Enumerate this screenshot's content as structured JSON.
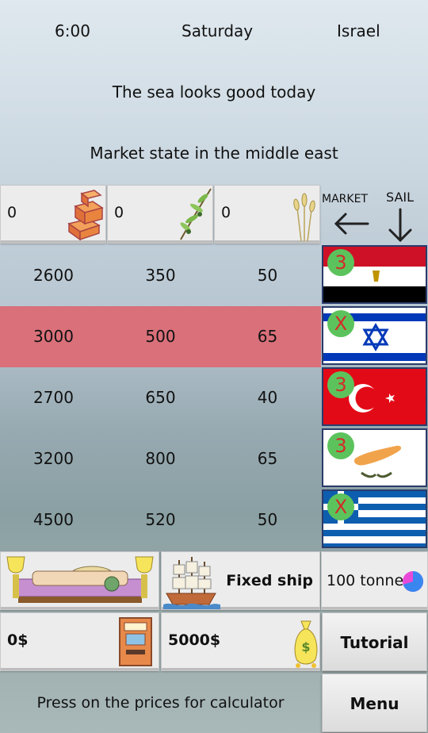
{
  "header": {
    "time": "6:00",
    "day": "Saturday",
    "location": "Israel"
  },
  "message": "The sea looks good today",
  "market_title": "Market state in the middle east",
  "goods": [
    {
      "name": "gold",
      "icon": "gold-bars-icon",
      "amount": "0"
    },
    {
      "name": "olive",
      "icon": "olive-branch-icon",
      "amount": "0"
    },
    {
      "name": "wheat",
      "icon": "wheat-icon",
      "amount": "0"
    }
  ],
  "nav": {
    "market_label": "MARKET",
    "sail_label": "SAIL"
  },
  "markets": [
    {
      "country": "Egypt",
      "prices": [
        "2600",
        "350",
        "50"
      ],
      "badge": "3",
      "current": false
    },
    {
      "country": "Israel",
      "prices": [
        "3000",
        "500",
        "65"
      ],
      "badge": "X",
      "current": true
    },
    {
      "country": "Turkey",
      "prices": [
        "2700",
        "650",
        "40"
      ],
      "badge": "3",
      "current": false
    },
    {
      "country": "Cyprus",
      "prices": [
        "3200",
        "800",
        "65"
      ],
      "badge": "3",
      "current": false
    },
    {
      "country": "Greece",
      "prices": [
        "4500",
        "520",
        "50"
      ],
      "badge": "X",
      "current": false
    }
  ],
  "ship": {
    "status": "Fixed ship",
    "capacity": "100 tonne",
    "capacity_fill": 0.7
  },
  "finance": {
    "bank": "0$",
    "cash": "5000$"
  },
  "buttons": {
    "tutorial": "Tutorial",
    "menu": "Menu"
  },
  "footer_hint": "Press on the prices for calculator",
  "colors": {
    "current_row": "#d9707a",
    "egypt_red": "#ce1126",
    "israel_blue": "#0038b8",
    "turkey_red": "#e30a17",
    "cyprus_copper": "#f1a34c",
    "greece_blue": "#0d5eaf"
  }
}
